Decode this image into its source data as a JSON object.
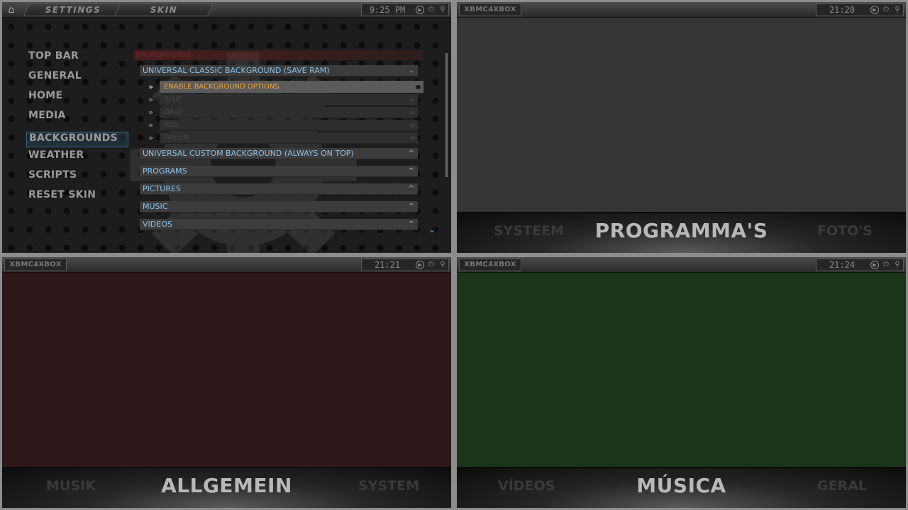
{
  "settings": {
    "breadcrumb": [
      "SETTINGS",
      "SKIN"
    ],
    "clock": "9:25 PM",
    "sidebar": [
      "TOP BAR",
      "GENERAL",
      "HOME",
      "MEDIA",
      "BACKGROUNDS",
      "WEATHER",
      "SCRIPTS",
      "RESET SKIN"
    ],
    "sidebar_active": "BACKGROUNDS",
    "list_header": "BACKGROUNDS",
    "classic": "UNIVERSAL CLASSIC BACKGROUND (SAVE RAM)",
    "options": [
      "ENABLE BACKGROUND OPTIONS",
      "BLUE",
      "GRAY",
      "RED",
      "GREEN"
    ],
    "groups": [
      "UNIVERSAL CUSTOM BACKGROUND (ALWAYS ON TOP)",
      "PROGRAMS",
      "PICTURES",
      "MUSIC",
      "VIDEOS"
    ],
    "icons": {
      "home": "home-icon",
      "expand": "chevron-down-icon",
      "collapse": "chevron-up-icon",
      "bullet": "double-chevron-icon"
    },
    "colors": {
      "accent": "#f0a338",
      "link": "#8ec3ec"
    }
  },
  "programmas": {
    "logo": "XBMC4XBOX",
    "clock": "21:20",
    "menu_left": "SYSTEEM",
    "menu_main": "PROGRAMMA'S",
    "menu_right": "FOTO'S",
    "background": "#353535"
  },
  "allgemein": {
    "logo": "XBMC4XBOX",
    "clock": "21:21",
    "menu_left": "MUSIK",
    "menu_main": "ALLGEMEIN",
    "menu_right": "SYSTEM",
    "background": "#2f1819"
  },
  "musica": {
    "logo": "XBMC4XBOX",
    "clock": "21:24",
    "menu_left": "VÍDEOS",
    "menu_main": "MÚSICA",
    "menu_right": "GERAL",
    "background": "#1b351a"
  },
  "topbar_icons": [
    "play-icon",
    "power-icon",
    "search-icon"
  ]
}
